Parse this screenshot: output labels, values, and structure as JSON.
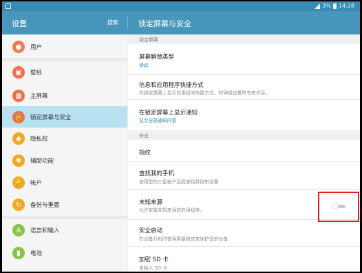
{
  "status_bar": {
    "battery": "3%",
    "time": "14:28"
  },
  "header": {
    "left_title": "设置",
    "search_label": "搜索",
    "right_title": "锁定屏幕与安全"
  },
  "nav": {
    "items": [
      {
        "label": "用户",
        "icon": "user-icon",
        "color": "#f07b4f"
      },
      {
        "label": "壁纸",
        "icon": "wallpaper-icon",
        "color": "#f06f45"
      },
      {
        "label": "主屏幕",
        "icon": "home-screen-icon",
        "color": "#f06f45"
      },
      {
        "label": "锁定屏幕与安全",
        "icon": "lock-icon",
        "color": "#f06f45"
      },
      {
        "label": "隐私权",
        "icon": "privacy-icon",
        "color": "#f5a623"
      },
      {
        "label": "辅助功能",
        "icon": "accessibility-icon",
        "color": "#f5a623"
      },
      {
        "label": "帐户",
        "icon": "key-icon",
        "color": "#f5a623"
      },
      {
        "label": "备份与重置",
        "icon": "backup-icon",
        "color": "#f5a623"
      },
      {
        "label": "语言和输入",
        "icon": "language-icon",
        "color": "#8bc34a"
      },
      {
        "label": "电池",
        "icon": "battery-icon",
        "color": "#8bc34a"
      }
    ]
  },
  "panel": {
    "section_lock": "锁定屏幕",
    "unlock_type": {
      "title": "屏幕解锁类型",
      "sub": "滑动"
    },
    "shortcuts": {
      "title": "信息和应用程序快捷方式",
      "sub": "在锁定屏幕上显示应用程序快捷方式、时钟或设备所有者信息。"
    },
    "notifications": {
      "title": "在锁定屏幕上显示通知",
      "sub": "显示全部通知内容"
    },
    "section_security": "安全",
    "fingerprint": {
      "title": "指纹"
    },
    "find_my": {
      "title": "查找我的手机",
      "sub": "使用您的三星帐户远程查找并控制设备"
    },
    "unknown_sources": {
      "title": "未知来源",
      "sub": "允许安装未知来源的应用程序。",
      "enabled": false
    },
    "secure_startup": {
      "title": "安全启动",
      "sub": "在设备开机时使用屏幕锁定来保护您的设备"
    },
    "encrypt_sd": {
      "title": "加密 SD 卡",
      "sub": "未插入 SD 卡"
    }
  }
}
